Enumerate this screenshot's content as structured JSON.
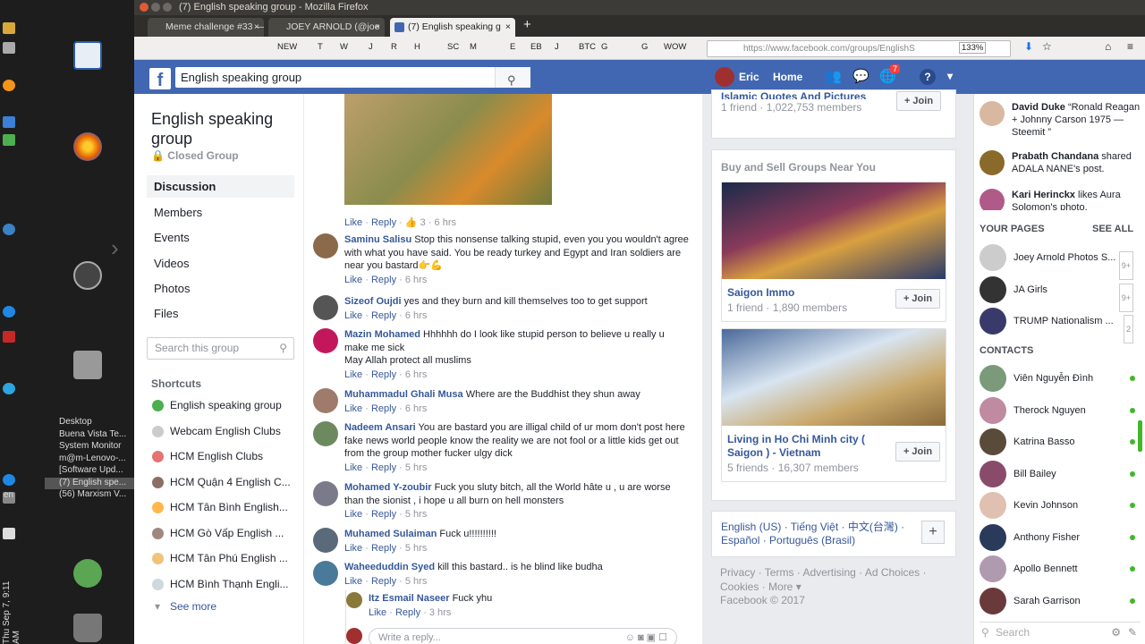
{
  "desktop": {
    "windows": [
      "Desktop",
      "Buena Vista Te...",
      "System Monitor",
      "m@m-Lenovo-...",
      "[Software Upd...",
      "(7) English spe...",
      "(56) Marxism V..."
    ],
    "clock": "Thu Sep 7, 9:11 AM",
    "lang": "en"
  },
  "browser": {
    "title": "(7) English speaking group - Mozilla Firefox",
    "tabs": [
      "Meme challenge #33 —",
      "JOEY ARNOLD (@joe",
      "(7) English speaking g"
    ],
    "url": "https://www.facebook.com/groups/EnglishS",
    "zoom": "133%",
    "bookmarks": [
      "NEW",
      "T",
      "W",
      "J",
      "R",
      "H",
      "SC",
      "M",
      "E",
      "EB",
      "J",
      "BTC",
      "G",
      "G",
      "WOW"
    ]
  },
  "fb": {
    "search": "English speaking group",
    "user": "Eric",
    "home": "Home",
    "notif_count": "7"
  },
  "group": {
    "title": "English speaking group",
    "privacy": "Closed Group",
    "nav": [
      "Discussion",
      "Members",
      "Events",
      "Videos",
      "Photos",
      "Files"
    ],
    "search_placeholder": "Search this group",
    "shortcuts_label": "Shortcuts",
    "shortcuts": [
      "English speaking group",
      "Webcam English Clubs",
      "HCM English Clubs",
      "HCM Quận 4 English C...",
      "HCM Tân Bình English...",
      "HCM Gò Vấp English ...",
      "HCM Tân Phú English ...",
      "HCM Bình Thạnh Engli..."
    ],
    "see_more": "See more"
  },
  "feed": {
    "post_actions": {
      "like": "Like",
      "reply": "Reply",
      "reacts": "3",
      "time": "6 hrs"
    },
    "comments": [
      {
        "name": "Saminu Salisu",
        "text": "Stop this nonsense talking stupid, even you you wouldn't agree with what you have said. You be ready turkey and Egypt and Iran soldiers are near you bastard👉💪",
        "time": "6 hrs"
      },
      {
        "name": "Sizeof Oujdi",
        "text": "yes and they burn and kill themselves too to get support",
        "time": "6 hrs"
      },
      {
        "name": "Mazin Mohamed",
        "text": "Hhhhhh do I look like stupid person to believe u really u make me sick",
        "text2": "May Allah protect all muslims",
        "time": "6 hrs"
      },
      {
        "name": "Muhammadul Ghali Musa",
        "text": "Where are the Buddhist they shun away",
        "time": "6 hrs"
      },
      {
        "name": "Nadeem Ansari",
        "text": "You are bastard you are illigal child of ur mom don't post here fake news world people know the reality we are not fool or a little kids get out from the group mother fucker ulgy dick",
        "time": "5 hrs"
      },
      {
        "name": "Mohamed Y-zoubir",
        "text": "Fuck you sluty bitch, all the World hâte u , u are worse than the sionist , i hope u all burn on hell monsters",
        "time": "5 hrs"
      },
      {
        "name": "Muhamed Sulaiman",
        "text": "Fuck u!!!!!!!!!!",
        "time": "5 hrs"
      },
      {
        "name": "Waheeduddin Syed",
        "text": "kill this bastard.. is he blind like budha",
        "time": "5 hrs"
      }
    ],
    "reply": {
      "name": "Itz Esmail Naseer",
      "text": "Fuck yhu",
      "time": "3 hrs"
    },
    "reply_placeholder": "Write a reply...",
    "like": "Like",
    "reply_label": "Reply"
  },
  "right": {
    "top_group": {
      "name": "Islamic Quotes And Pictures",
      "meta": "1 friend · 1,022,753 members"
    },
    "section": "Buy and Sell Groups Near You",
    "groups": [
      {
        "name": "Saigon Immo",
        "meta": "1 friend · 1,890 members"
      },
      {
        "name": "Living in Ho Chi Minh city ( Saigon ) - Vietnam",
        "meta": "5 friends · 16,307 members"
      }
    ],
    "join": "Join",
    "langs": "English (US) · Tiếng Việt · 中文(台灣) · Español · Português (Brasil)",
    "footer": "Privacy · Terms · Advertising · Ad Choices · Cookies · More ▾",
    "copyright": "Facebook © 2017"
  },
  "ticker": {
    "items": [
      {
        "name": "David Duke",
        "text": "“Ronald Reagan + Johnny Carson 1975 — Steemit ”"
      },
      {
        "name": "Prabath Chandana",
        "text": "shared ADALA NANE's post."
      },
      {
        "name": "Kari Herinckx",
        "text": "likes Aura Solomon's photo."
      }
    ],
    "pages_label": "YOUR PAGES",
    "see_all": "SEE ALL",
    "pages": [
      {
        "name": "Joey Arnold Photos S...",
        "count": "9+"
      },
      {
        "name": "JA Girls",
        "count": "9+"
      },
      {
        "name": "TRUMP Nationalism ...",
        "count": "2"
      }
    ],
    "contacts_label": "CONTACTS",
    "contacts": [
      "Viên Nguyễn Đình",
      "Therock Nguyen",
      "Katrina Basso",
      "Bill Bailey",
      "Kevin Johnson",
      "Anthony Fisher",
      "Apollo Bennett",
      "Sarah Garrison"
    ],
    "search": "Search"
  }
}
